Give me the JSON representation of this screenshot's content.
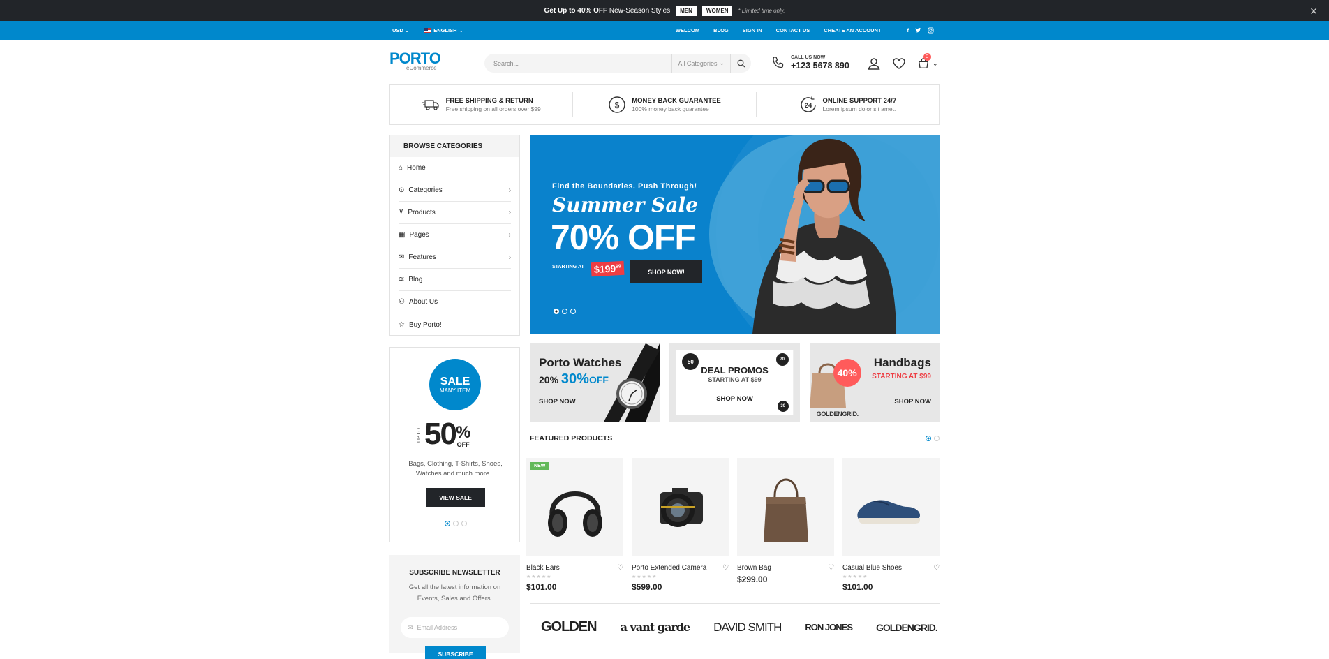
{
  "notice": {
    "pre": "Get Up to",
    "bold": "40% OFF",
    "post": "New-Season Styles",
    "men": "MEN",
    "women": "WOMEN",
    "small": "* Limited time only.",
    "close": "✕"
  },
  "topbar": {
    "currency": "USD",
    "language": "ENGLISH",
    "links": [
      "WELCOM",
      "BLOG",
      "SIGN IN",
      "CONTACT US",
      "CREATE AN ACCOUNT"
    ]
  },
  "header": {
    "logo": "PORTO",
    "logo_sub": "eCommerce",
    "search_placeholder": "Search...",
    "search_category": "All Categories",
    "call_label": "CALL US NOW",
    "call_number": "+123 5678 890",
    "cart_count": "0"
  },
  "info": [
    {
      "title": "FREE SHIPPING & RETURN",
      "sub": "Free shipping on all orders over $99",
      "icon": "truck-icon"
    },
    {
      "title": "MONEY BACK GUARANTEE",
      "sub": "100% money back guarantee",
      "icon": "dollar-icon"
    },
    {
      "title": "ONLINE SUPPORT 24/7",
      "sub": "Lorem ipsum dolor sit amet.",
      "icon": "support-24-icon"
    }
  ],
  "categories": {
    "title": "BROWSE CATEGORIES",
    "items": [
      {
        "label": "Home",
        "arrow": ""
      },
      {
        "label": "Categories",
        "arrow": "›"
      },
      {
        "label": "Products",
        "arrow": "›"
      },
      {
        "label": "Pages",
        "arrow": "›"
      },
      {
        "label": "Features",
        "arrow": "›"
      },
      {
        "label": "Blog",
        "arrow": ""
      },
      {
        "label": "About Us",
        "arrow": ""
      },
      {
        "label": "Buy Porto!",
        "arrow": ""
      }
    ]
  },
  "sale": {
    "badge": "SALE",
    "badge_sub": "MANY ITEM",
    "upto": "UP TO",
    "number": "50",
    "percent": "%",
    "off": "OFF",
    "desc": "Bags, Clothing, T-Shirts, Shoes, Watches and much more...",
    "button": "VIEW SALE"
  },
  "newsletter": {
    "title": "SUBSCRIBE NEWSLETTER",
    "text": "Get all the latest information on Events, Sales and Offers.",
    "placeholder": "Email Address",
    "button": "SUBSCRIBE"
  },
  "hero": {
    "kicker": "Find the Boundaries. Push Through!",
    "title": "Summer Sale",
    "offer": "70% OFF",
    "starting": "STARTING AT",
    "price": "$199",
    "price_cents": "99",
    "button": "SHOP NOW!"
  },
  "banners": {
    "b1": {
      "title": "Porto Watches",
      "old": "20%",
      "new": "30%",
      "off": "OFF",
      "cta": "SHOP NOW"
    },
    "b2": {
      "title": "DEAL PROMOS",
      "sub": "STARTING AT $99",
      "cta": "SHOP NOW",
      "c1": "50",
      "c2": "70",
      "c3": "30"
    },
    "b3": {
      "title": "Handbags",
      "sub": "STARTING AT $99",
      "cta": "SHOP NOW",
      "pct": "40%",
      "brand": "GOLDENGRID."
    }
  },
  "featured": {
    "title": "FEATURED PRODUCTS",
    "products": [
      {
        "name": "Black Ears",
        "price": "$101.00",
        "tag": "NEW",
        "stars": "★★★★★"
      },
      {
        "name": "Porto Extended Camera",
        "price": "$599.00",
        "tag": "",
        "stars": "★★★★★"
      },
      {
        "name": "Brown Bag",
        "price": "$299.00",
        "tag": "",
        "stars": ""
      },
      {
        "name": "Casual Blue Shoes",
        "price": "$101.00",
        "tag": "",
        "stars": "★★★★★"
      }
    ]
  },
  "brands": [
    "GOLDEN",
    "a vant garde",
    "DAVID SMITH",
    "RON JONES",
    "GOLDENGRID."
  ],
  "colors": {
    "accent": "#0088cc",
    "dark": "#222529",
    "sale_red": "#ee3d43"
  }
}
